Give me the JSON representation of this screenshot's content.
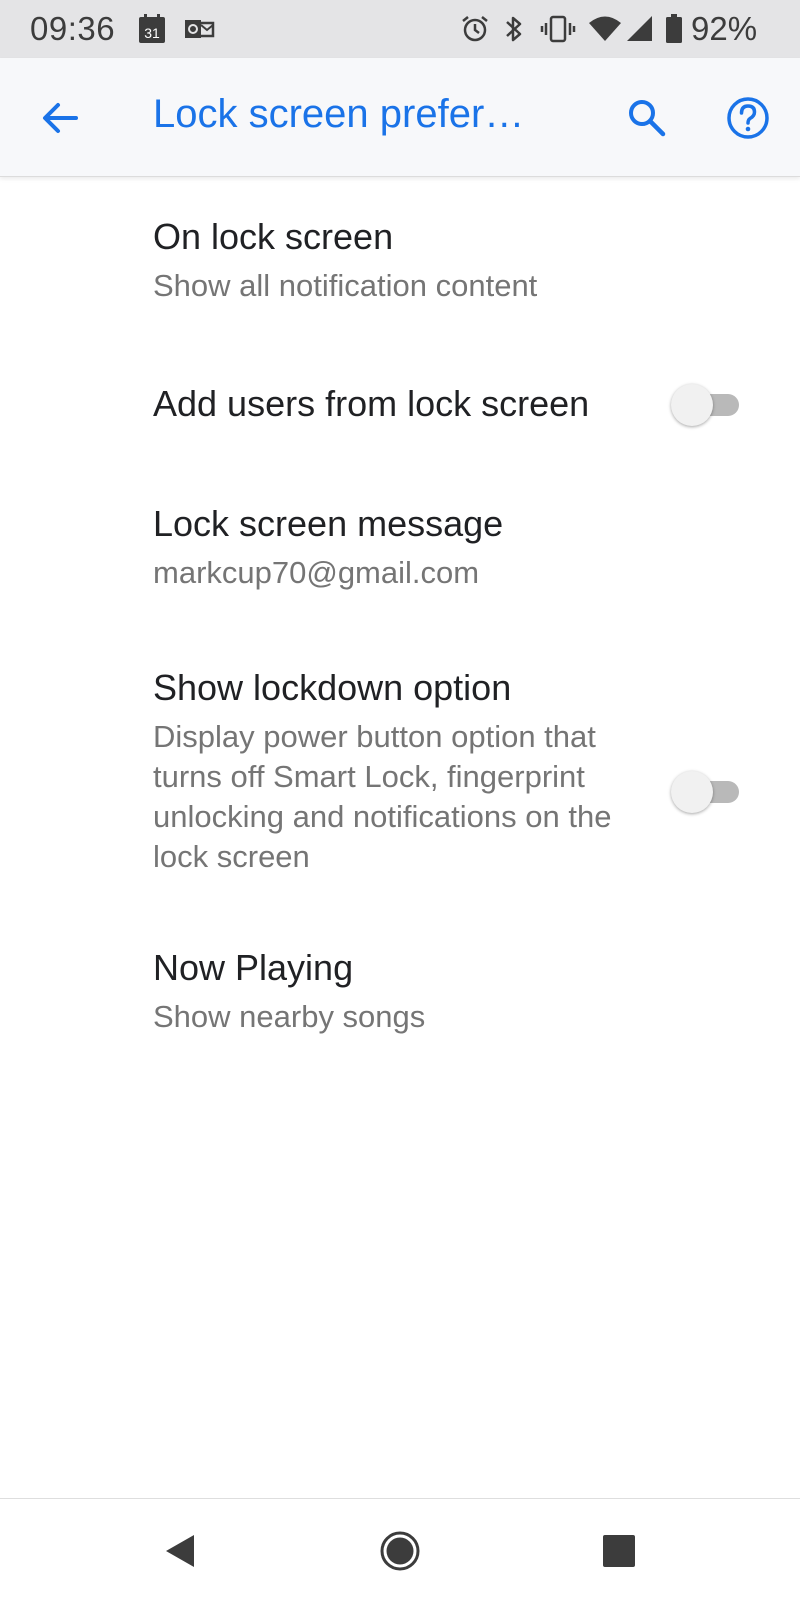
{
  "status_bar": {
    "time": "09:36",
    "battery_percent": "92%",
    "calendar_badge": "31",
    "left_icons": [
      "calendar-icon",
      "outlook-icon"
    ],
    "right_icons": [
      "alarm-icon",
      "bluetooth-icon",
      "vibrate-icon",
      "wifi-icon",
      "signal-icon",
      "battery-icon"
    ]
  },
  "app_bar": {
    "title": "Lock screen prefer…",
    "back_icon": "back-arrow-icon",
    "search_icon": "search-icon",
    "help_icon": "help-icon",
    "accent_color": "#1a73e8"
  },
  "preferences": [
    {
      "title": "On lock screen",
      "summary": "Show all notification content",
      "has_toggle": false
    },
    {
      "title": "Add users from lock screen",
      "summary": "",
      "has_toggle": true,
      "toggle_on": false
    },
    {
      "title": "Lock screen message",
      "summary": "markcup70@gmail.com",
      "has_toggle": false
    },
    {
      "title": "Show lockdown option",
      "summary": "Display power button option that turns off Smart Lock, fingerprint unlocking and notifications on the lock screen",
      "has_toggle": true,
      "toggle_on": false
    },
    {
      "title": "Now Playing",
      "summary": "Show nearby songs",
      "has_toggle": false
    }
  ],
  "nav_bar": {
    "icons": [
      "nav-back-icon",
      "nav-home-icon",
      "nav-recents-icon"
    ]
  }
}
